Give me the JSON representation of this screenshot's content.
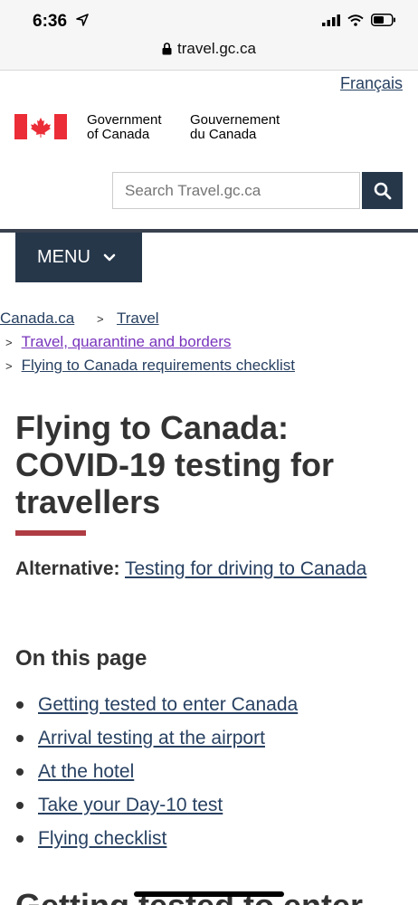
{
  "status_bar": {
    "time": "6:36",
    "url": "travel.gc.ca"
  },
  "header": {
    "language_link": "Français",
    "gov_en_line1": "Government",
    "gov_en_line2": "of Canada",
    "gov_fr_line1": "Gouvernement",
    "gov_fr_line2": "du Canada",
    "search_placeholder": "Search Travel.gc.ca",
    "menu_label": "MENU"
  },
  "breadcrumb": [
    {
      "label": "Canada.ca"
    },
    {
      "label": "Travel"
    },
    {
      "label": "Travel, quarantine and borders"
    },
    {
      "label": "Flying to Canada requirements checklist"
    }
  ],
  "main": {
    "title": "Flying to Canada: COVID-19 testing for travellers",
    "alternative_label": "Alternative:",
    "alternative_link": "Testing for driving to Canada",
    "on_this_page_heading": "On this page",
    "toc": [
      {
        "label": "Getting tested to enter Canada"
      },
      {
        "label": "Arrival testing at the airport"
      },
      {
        "label": "At the hotel"
      },
      {
        "label": "Take your Day-10 test"
      },
      {
        "label": "Flying checklist"
      }
    ],
    "next_heading": "Getting tested to enter"
  },
  "colors": {
    "link": "#284162",
    "visited_link": "#7834bc",
    "accent_bar": "#af3c43",
    "menu_bg": "#26374a",
    "flag_red": "#eb2d37"
  }
}
